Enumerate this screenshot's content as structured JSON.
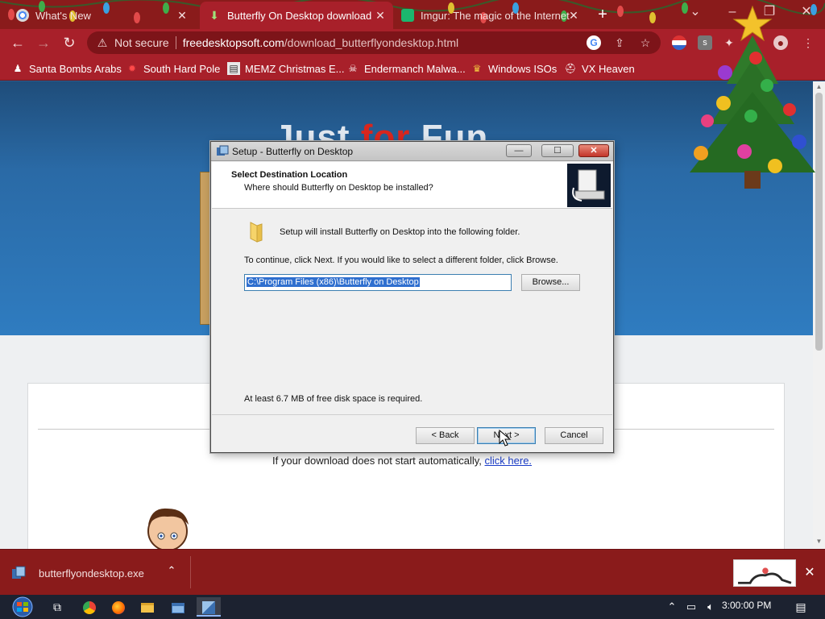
{
  "browser": {
    "tabs": [
      {
        "label": "What's New",
        "active": false
      },
      {
        "label": "Butterfly On Desktop download",
        "active": true
      },
      {
        "label": "Imgur: The magic of the Internet",
        "active": false
      }
    ],
    "new_tab_icon": "plus-icon",
    "window_controls": [
      "chevron-down-icon",
      "minimize-icon",
      "maximize-icon",
      "close-icon"
    ],
    "security_label": "Not secure",
    "url_host": "freedesktopsoft.com",
    "url_path": "/download_butterflyondesktop.html",
    "bookmarks": [
      {
        "label": "Santa Bombs Arabs",
        "icon": "santa-icon"
      },
      {
        "label": "South Hard Pole",
        "icon": "red-ornament-icon"
      },
      {
        "label": "MEMZ Christmas E...",
        "icon": "page-icon"
      },
      {
        "label": "Endermanch Malwa...",
        "icon": "skull-icon"
      },
      {
        "label": "Windows ISOs",
        "icon": "folder-person-icon"
      },
      {
        "label": "VX Heaven",
        "icon": "helmet-icon"
      }
    ]
  },
  "page": {
    "hero_title_part1": "Just ",
    "hero_title_part2": "for",
    "hero_title_part3": " Fun",
    "download_note": "If your download does not start automatically, ",
    "download_link": "click here."
  },
  "dialog": {
    "title": "Setup - Butterfly on Desktop",
    "header_title": "Select Destination Location",
    "header_subtitle": "Where should Butterfly on Desktop be installed?",
    "install_line": "Setup will install Butterfly on Desktop into the following folder.",
    "instruction": "To continue, click Next. If you would like to select a different folder, click Browse.",
    "path_value": "C:\\Program Files (x86)\\Butterfly on Desktop",
    "browse_label": "Browse...",
    "disk_space": "At least 6.7 MB of free disk space is required.",
    "back_label": "< Back",
    "next_label": "Next >",
    "cancel_label": "Cancel"
  },
  "download_shelf": {
    "filename": "butterflyondesktop.exe"
  },
  "taskbar": {
    "clock": "3:00:00 PM"
  },
  "colors": {
    "chrome_dark": "#8a1b1b",
    "chrome_accent": "#a8202a",
    "link": "#1a3cc8",
    "selection": "#2f6fcf"
  }
}
